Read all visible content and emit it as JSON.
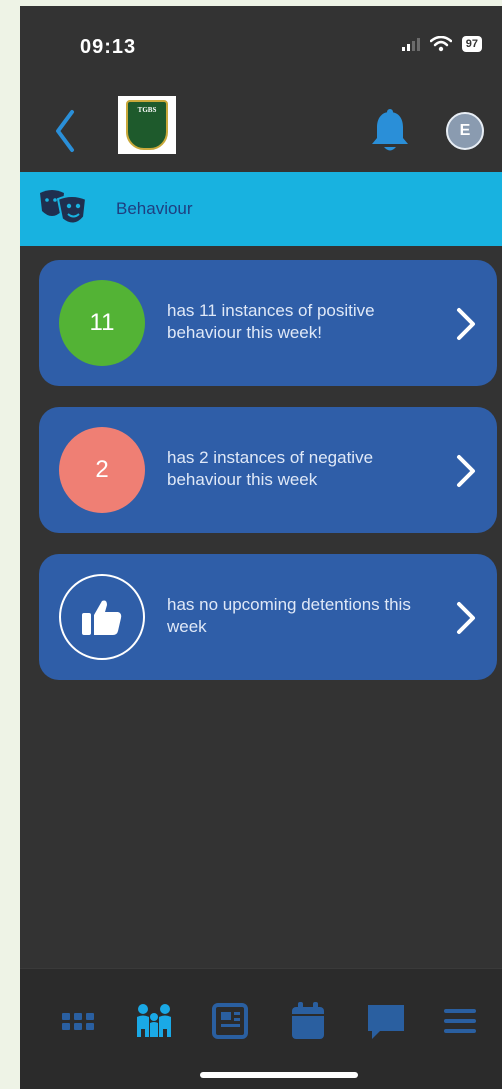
{
  "status_bar": {
    "time": "09:13",
    "battery": "97"
  },
  "header": {
    "logo_text": "TGBS",
    "avatar_initial": "E"
  },
  "section": {
    "title": "Behaviour"
  },
  "cards": [
    {
      "badge": "11",
      "text": "has 11 instances of positive behaviour this week!",
      "color": "#53b335"
    },
    {
      "badge": "2",
      "text": "has 2 instances of negative behaviour this week",
      "color": "#ef7f74"
    },
    {
      "badge_icon": "thumbs-up-icon",
      "text": "has no upcoming detentions this week"
    }
  ],
  "bottom_nav": {
    "items": [
      "grid-icon",
      "people-icon",
      "newspaper-icon",
      "calendar-icon",
      "chat-icon",
      "menu-icon"
    ],
    "active": "people-icon"
  },
  "colors": {
    "background": "#333333",
    "section_bar": "#18b2e0",
    "card": "#2f5ea8",
    "accent": "#2a8fd8"
  }
}
